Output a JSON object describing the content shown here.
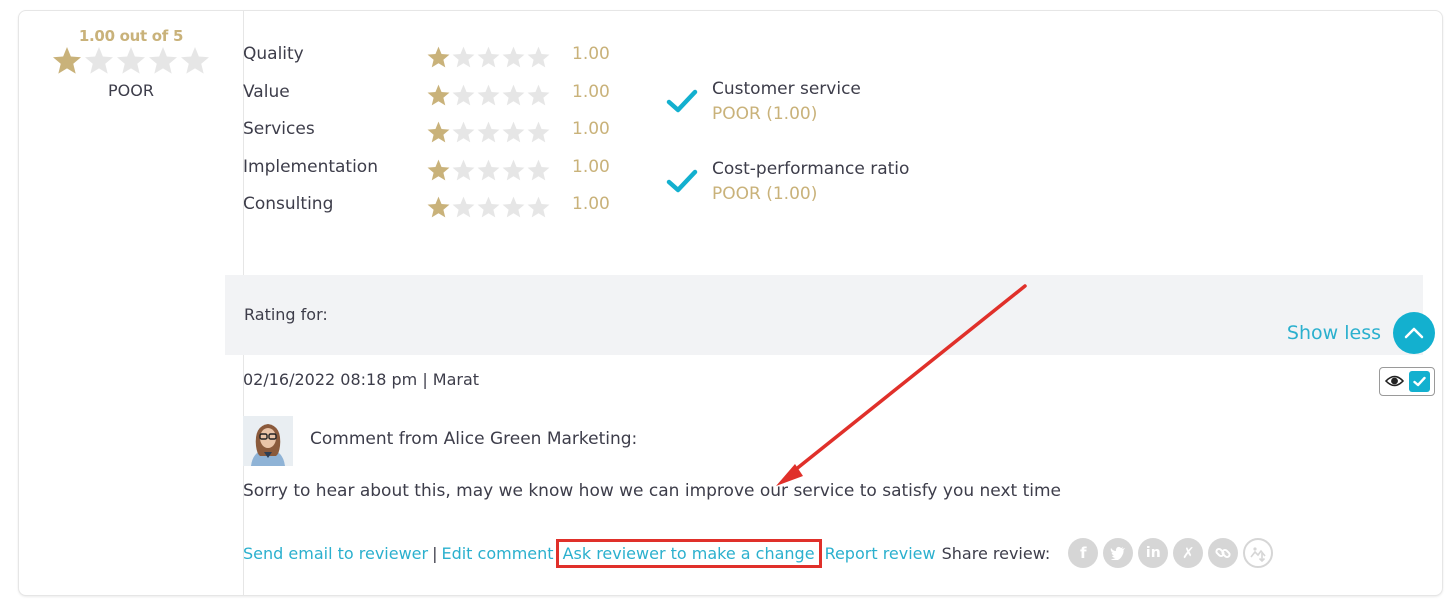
{
  "overall": {
    "score_text": "1.00 out of 5",
    "rating": 1,
    "max_rating": 5,
    "label": "POOR"
  },
  "criteria": [
    {
      "label": "Quality",
      "rating": 1,
      "value": "1.00"
    },
    {
      "label": "Value",
      "rating": 1,
      "value": "1.00"
    },
    {
      "label": "Services",
      "rating": 1,
      "value": "1.00"
    },
    {
      "label": "Implementation",
      "rating": 1,
      "value": "1.00"
    },
    {
      "label": "Consulting",
      "rating": 1,
      "value": "1.00"
    }
  ],
  "recommendations": [
    {
      "title": "Customer service",
      "value": "POOR (1.00)"
    },
    {
      "title": "Cost-performance ratio",
      "value": "POOR (1.00)"
    }
  ],
  "rating_for": {
    "label": "Rating for:"
  },
  "show_less": {
    "label": "Show less"
  },
  "review": {
    "meta": "02/16/2022 08:18 pm | Marat",
    "comment_from": "Comment from Alice Green Marketing:",
    "comment_text": "Sorry to hear about this, may we know how we can improve our service to satisfy you next time"
  },
  "actions": {
    "send_email": "Send email to reviewer",
    "separator": "|",
    "edit_comment": "Edit comment",
    "ask_change": "Ask reviewer to make a change",
    "report": "Report review",
    "share_label": "Share review:"
  },
  "share_icons": [
    {
      "name": "facebook-icon",
      "glyph": "f"
    },
    {
      "name": "twitter-icon",
      "glyph": "🐦"
    },
    {
      "name": "linkedin-icon",
      "glyph": "in"
    },
    {
      "name": "xing-icon",
      "glyph": "X"
    },
    {
      "name": "link-icon",
      "glyph": "🔗"
    },
    {
      "name": "image-share-icon",
      "glyph": ""
    }
  ],
  "colors": {
    "gold": "#c9b27a",
    "accent": "#13b0cf",
    "link": "#2bb0ce",
    "annotation_red": "#e0302a",
    "empty_star": "#e6e6e6"
  }
}
